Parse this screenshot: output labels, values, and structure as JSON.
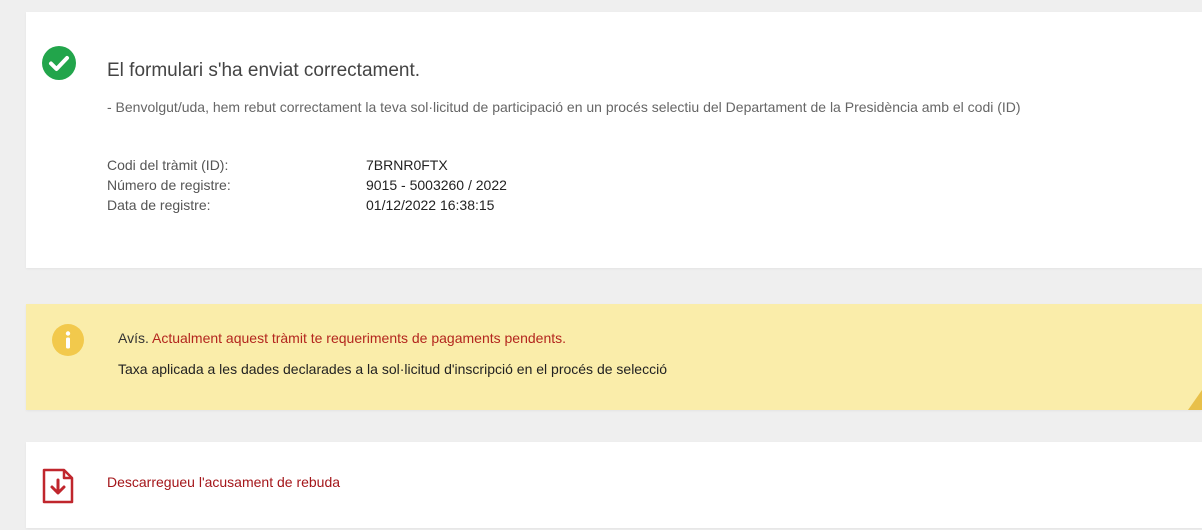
{
  "success": {
    "title": "El formulari s'ha enviat correctament.",
    "message": "- Benvolgut/uda, hem rebut correctament la teva sol·licitud de participació en un procés selectiu del Departament de la Presidència amb el codi (ID)",
    "rows": [
      {
        "label": "Codi del tràmit (ID):",
        "value": "7BRNR0FTX"
      },
      {
        "label": "Número de registre:",
        "value": "9015 - 5003260 / 2022"
      },
      {
        "label": "Data de registre:",
        "value": "01/12/2022 16:38:15"
      }
    ],
    "icon": "check-circle-icon",
    "color": "#22a54b"
  },
  "warning": {
    "prefix": "Avís.",
    "text": "Actualment aquest tràmit te requeriments de pagaments pendents.",
    "detail": "Taxa aplicada a les dades declarades a la sol·licitud d'inscripció en el procés de selecció",
    "icon": "info-circle-icon",
    "background": "#faedaa",
    "text_color": "#b3261e"
  },
  "download": {
    "label": "Descarregueu l'acusament de rebuda",
    "icon": "pdf-download-icon",
    "color": "#a4161a"
  }
}
